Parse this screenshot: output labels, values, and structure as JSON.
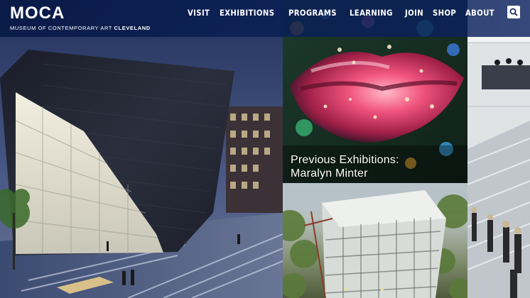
{
  "header": {
    "logo_text": "MOCA",
    "logo_subtitle_prefix": "MUSEUM OF CONTEMPORARY ART",
    "logo_subtitle_city": "CLEVELAND",
    "nav": [
      {
        "label": "VISIT"
      },
      {
        "label": "EXHIBITIONS"
      },
      {
        "label": "PROGRAMS"
      },
      {
        "label": "LEARNING"
      },
      {
        "label": "JOIN"
      },
      {
        "label": "SHOP"
      },
      {
        "label": "ABOUT"
      }
    ],
    "search_icon": "search-icon"
  },
  "tiles": {
    "feature": {
      "caption_line1": "Previous Exhibitions:",
      "caption_line2": "Maralyn Minter"
    }
  },
  "colors": {
    "header_bg": "#0a1e55",
    "accent_white": "#ffffff"
  }
}
